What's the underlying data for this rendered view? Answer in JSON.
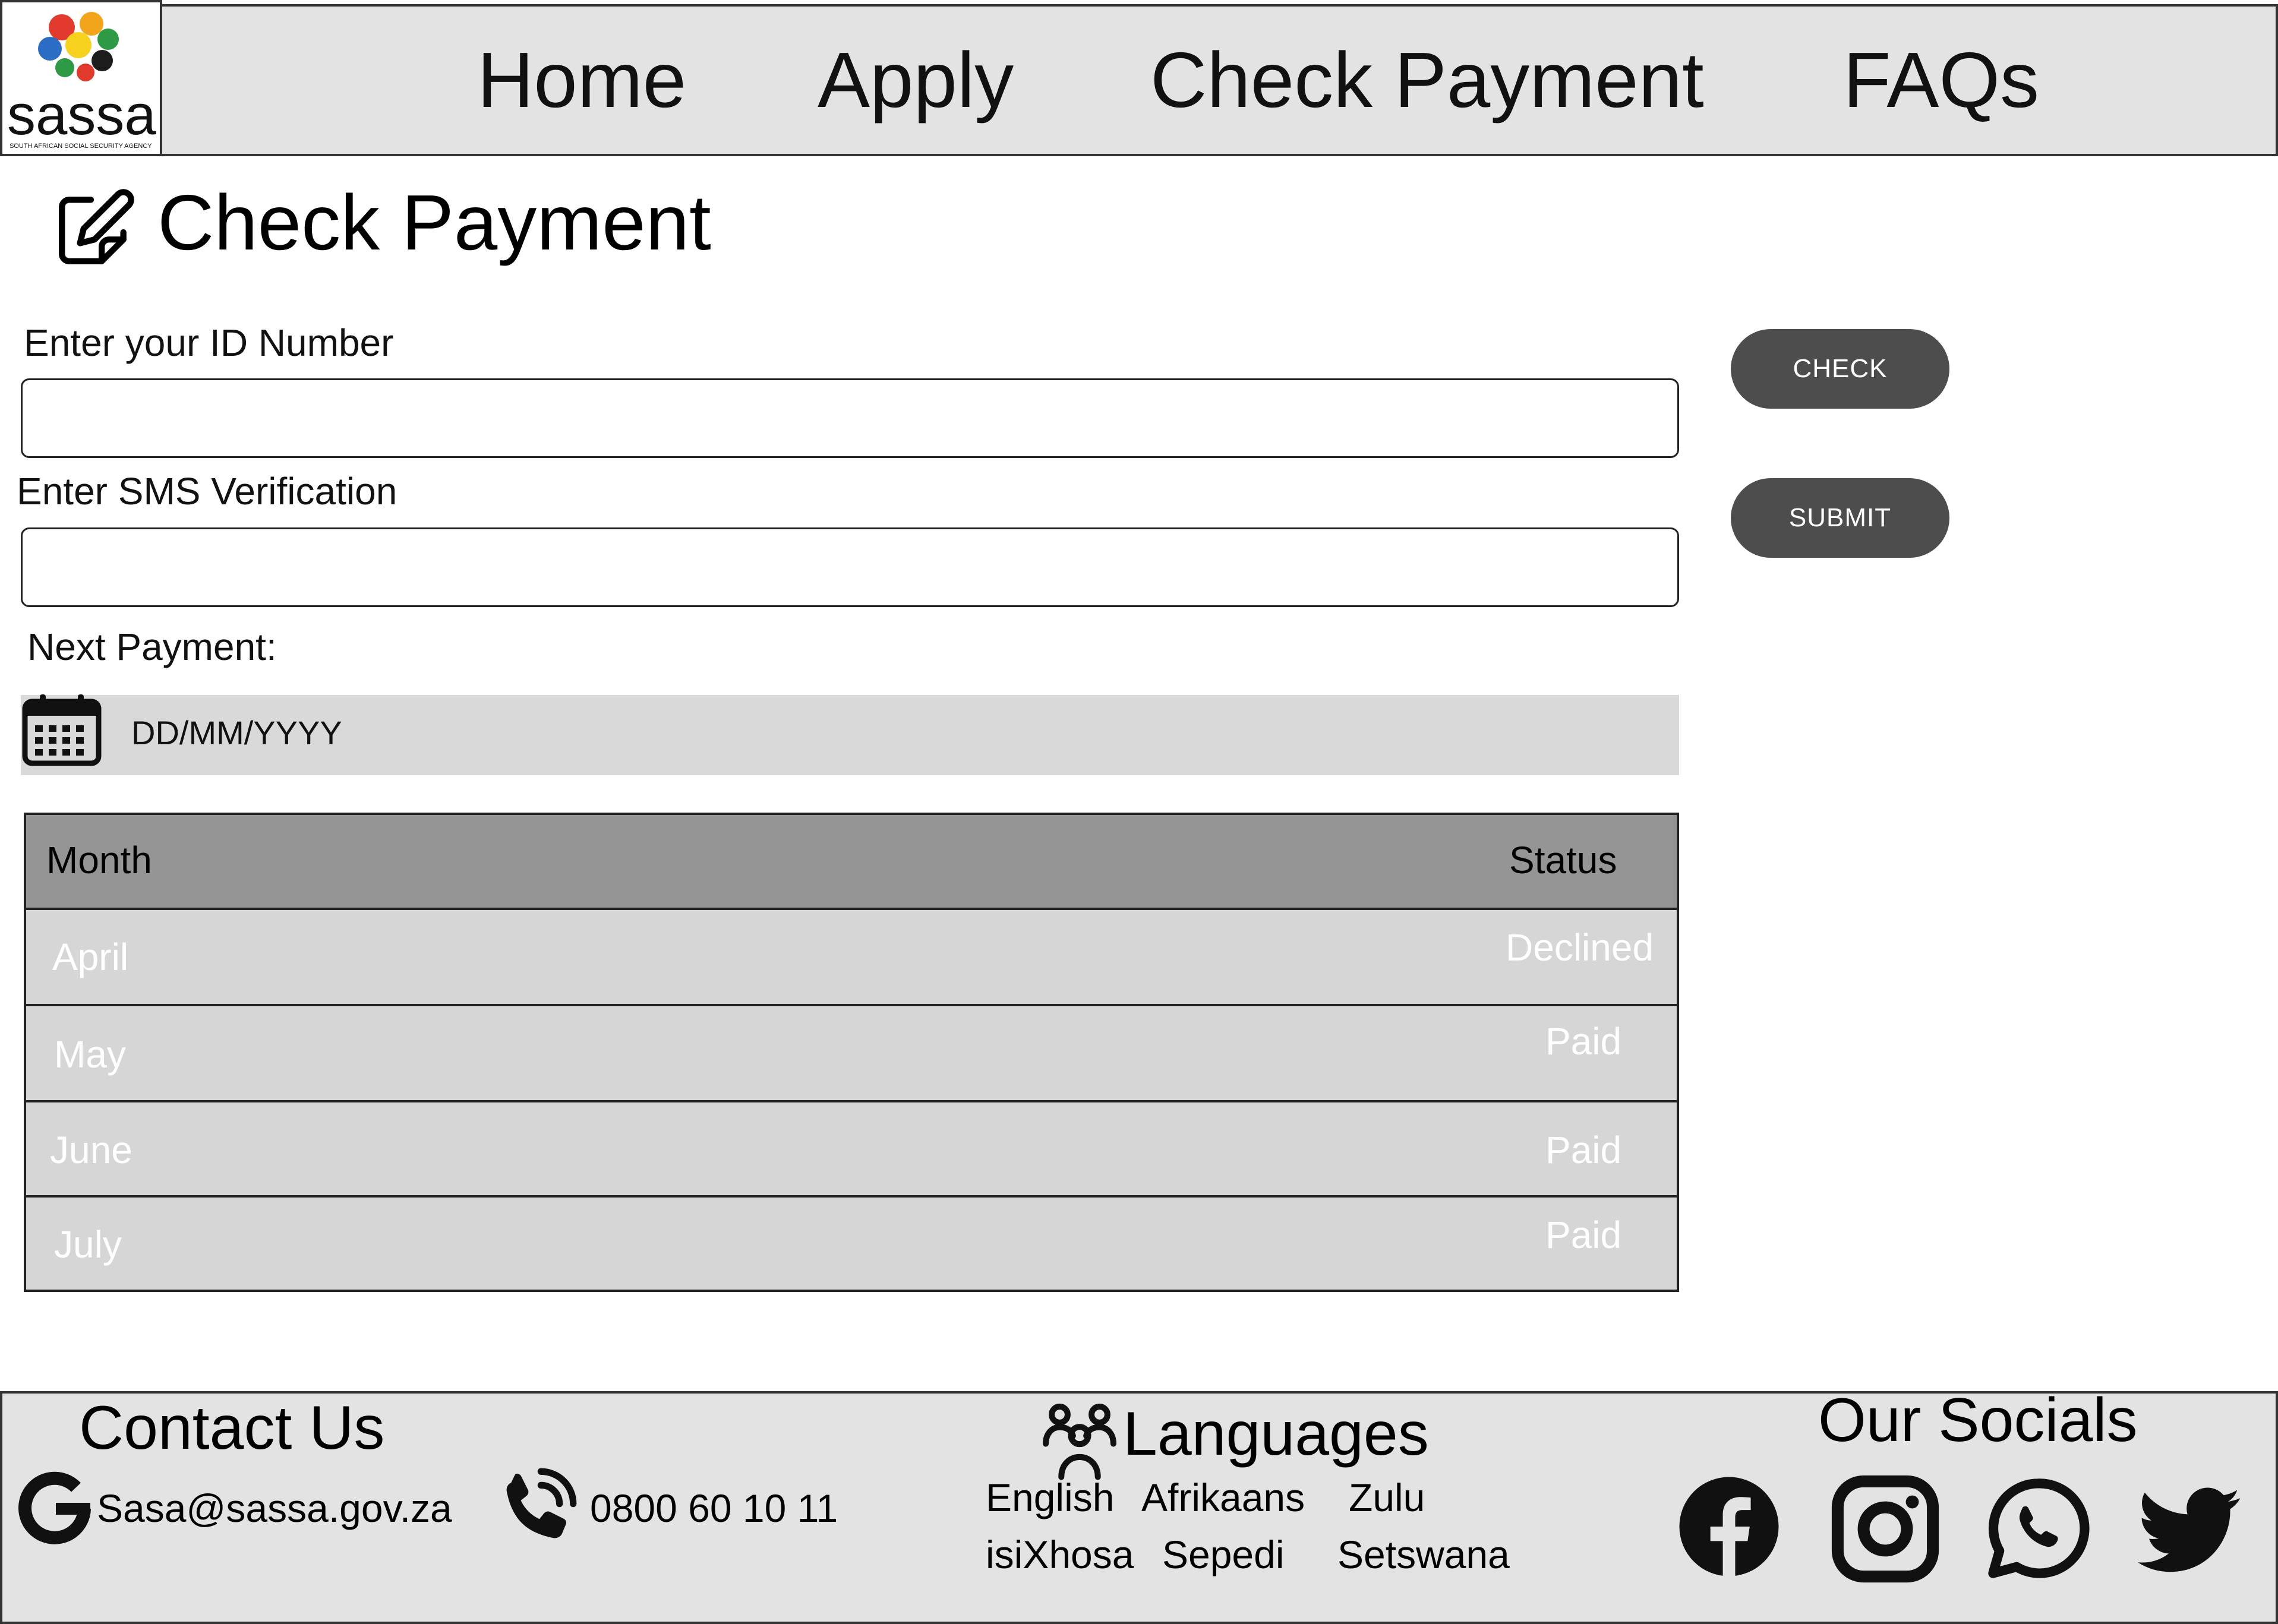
{
  "header": {
    "logo_text": "sassa",
    "logo_tagline": "SOUTH AFRICAN SOCIAL SECURITY AGENCY",
    "nav": [
      "Home",
      "Apply",
      "Check Payment",
      "FAQs"
    ]
  },
  "page": {
    "title": "Check Payment",
    "id_label": "Enter your ID Number",
    "id_value": "",
    "sms_label": "Enter SMS Verification",
    "sms_value": "",
    "check_button": "CHECK",
    "submit_button": "SUBMIT",
    "next_payment_label": "Next Payment:",
    "next_payment_date": "DD/MM/YYYY"
  },
  "table": {
    "headers": [
      "Month",
      "Status"
    ],
    "rows": [
      {
        "month": "April",
        "status": "Declined"
      },
      {
        "month": "May",
        "status": "Paid"
      },
      {
        "month": "June",
        "status": "Paid"
      },
      {
        "month": "July",
        "status": "Paid"
      }
    ]
  },
  "footer": {
    "contact_title": "Contact Us",
    "email": "Sasa@sassa.gov.za",
    "phone": "0800 60 10 11",
    "languages_title": "Languages",
    "languages": [
      "English",
      "Afrikaans",
      "Zulu",
      "isiXhosa",
      "Sepedi",
      "Setswana"
    ],
    "socials_title": "Our Socials",
    "socials": [
      "facebook-icon",
      "instagram-icon",
      "whatsapp-icon",
      "twitter-icon"
    ]
  },
  "colors": {
    "header_bg": "#e3e3e3",
    "button_bg": "#4d4d4d",
    "table_header_bg": "#959595",
    "table_row_bg": "#d6d6d6",
    "date_bar_bg": "#d9d9d9"
  }
}
